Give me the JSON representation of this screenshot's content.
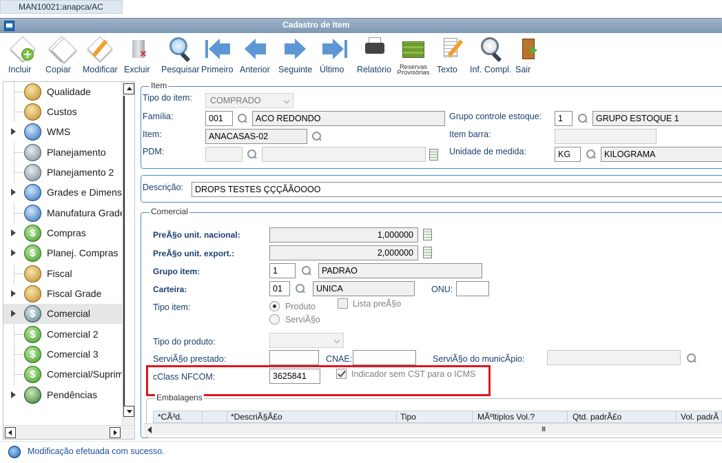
{
  "window": {
    "tab": "MAN10021:anapca/AC",
    "title": "Cadastro de Item"
  },
  "toolbar": {
    "incluir": "Incluir",
    "copiar": "Copiar",
    "modificar": "Modificar",
    "excluir": "Excluir",
    "pesquisar": "Pesquisar",
    "primeiro": "Primeiro",
    "anterior": "Anterior",
    "seguinte": "Seguinte",
    "ultimo": "Último",
    "relatorio": "Relatório",
    "reservas_1": "Reservas",
    "reservas_2": "Provisórias",
    "texto": "Texto",
    "inf_compl": "Inf. Compl.",
    "sair": "Sair"
  },
  "sidebar": {
    "items": [
      {
        "label": "Qualidade",
        "icon": "gold-circle-icon"
      },
      {
        "label": "Custos",
        "icon": "gold-person-icon"
      },
      {
        "label": "WMS",
        "icon": "blue-globe-icon"
      },
      {
        "label": "Planejamento",
        "icon": "gray-gear-icon"
      },
      {
        "label": "Planejamento 2",
        "icon": "gray-gear-icon"
      },
      {
        "label": "Grades e Dimensi",
        "icon": "blue-person-icon"
      },
      {
        "label": "Manufatura Grade",
        "icon": "blue-person-icon"
      },
      {
        "label": "Compras",
        "icon": "dollar-icon"
      },
      {
        "label": "Planej. Compras",
        "icon": "dollar-icon"
      },
      {
        "label": "Fiscal",
        "icon": "gold-person-icon"
      },
      {
        "label": "Fiscal Grade",
        "icon": "gold-person-icon"
      },
      {
        "label": "Comercial",
        "icon": "dollar-icon"
      },
      {
        "label": "Comercial 2",
        "icon": "dollar-icon"
      },
      {
        "label": "Comercial 3",
        "icon": "dollar-icon"
      },
      {
        "label": "Comercial/Suprim",
        "icon": "dollar-icon"
      },
      {
        "label": "Pendências",
        "icon": "globe-icon"
      }
    ]
  },
  "item": {
    "legend": "Item",
    "tipo_label": "Tipo do item:",
    "tipo_value": "COMPRADO",
    "familia_label": "Família:",
    "familia_code": "001",
    "familia_desc": "ACO REDONDO",
    "item_label": "Item:",
    "item_value": "ANACASAS-02",
    "pdm_label": "PDM:",
    "grupo_estoque_label": "Grupo controle estoque:",
    "grupo_estoque_code": "1",
    "grupo_estoque_desc": "GRUPO ESTOQUE 1",
    "item_barra_label": "Item barra:",
    "unidade_label": "Unidade de medida:",
    "unidade_code": "KG",
    "unidade_desc": "KILOGRAMA"
  },
  "descricao": {
    "label": "Descrição:",
    "value": "DROPS TESTES ÇÇÇÃÃOOOO"
  },
  "comercial": {
    "legend": "Comercial",
    "preco_nac_label": "PreÃ§o unit. nacional:",
    "preco_nac_value": "1,000000",
    "preco_exp_label": "PreÃ§o unit. export.:",
    "preco_exp_value": "2,000000",
    "grupo_item_label": "Grupo item:",
    "grupo_item_code": "1",
    "grupo_item_desc": "PADRAO",
    "carteira_label": "Carteira:",
    "carteira_code": "01",
    "carteira_desc": "UNICA",
    "onu_label": "ONU:",
    "tipo_item_label": "Tipo item:",
    "produto_label": "Produto",
    "servico_label": "ServiÃ§o",
    "lista_preco_label": "Lista preÃ§o",
    "tipo_produto_label": "Tipo do produto:",
    "servico_prestado_label": "ServiÃ§o prestado:",
    "cnae_label": "CNAE:",
    "servico_municipio_label": "ServiÃ§o do municÃpio:",
    "cclass_label": "cClass NFCOM:",
    "cclass_value": "3625841",
    "indicador_label": "Indicador sem CST para o ICMS"
  },
  "embalagens": {
    "legend": "Embalagens",
    "columns": [
      "*CÃ³d.",
      "*DescriÃ§Ã£o",
      "Tipo",
      "MÃºltiplos Vol.?",
      "Qtd. padrÃ£o",
      "Vol. padrÃ"
    ],
    "scroll_grip": "III"
  },
  "status": {
    "message": "Modificação efetuada com sucesso."
  }
}
